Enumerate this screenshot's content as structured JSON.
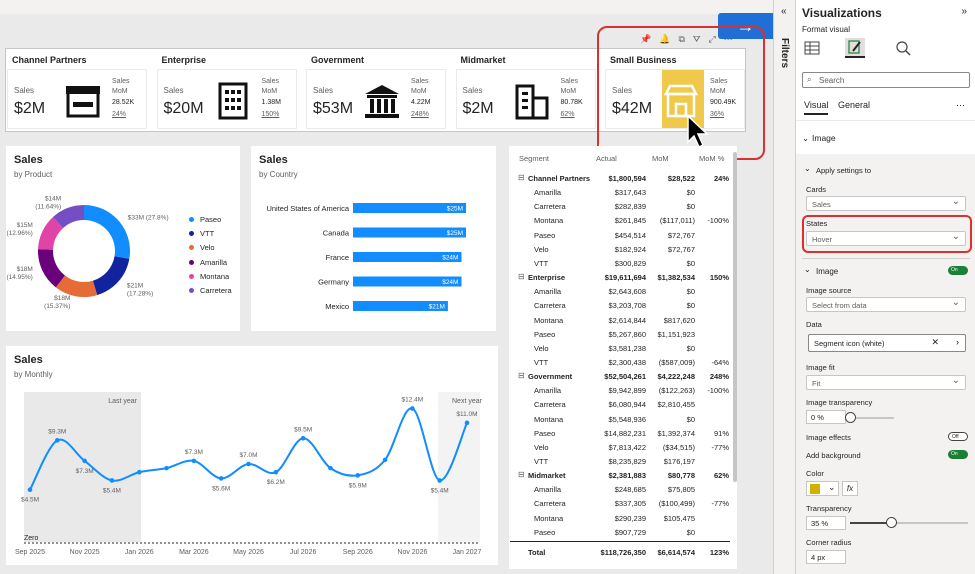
{
  "cards": [
    {
      "title": "Channel Partners",
      "sales_label": "Sales",
      "value": "$2M",
      "mom_label": "Sales MoM",
      "mom": "28.52K",
      "pct": "24%",
      "icon": "storefront-icon"
    },
    {
      "title": "Enterprise",
      "sales_label": "Sales",
      "value": "$20M",
      "mom_label": "Sales MoM",
      "mom": "1.38M",
      "pct": "150%",
      "icon": "office-building-icon"
    },
    {
      "title": "Government",
      "sales_label": "Sales",
      "value": "$53M",
      "mom_label": "Sales MoM",
      "mom": "4.22M",
      "pct": "248%",
      "icon": "government-building-icon"
    },
    {
      "title": "Midmarket",
      "sales_label": "Sales",
      "value": "$2M",
      "mom_label": "Sales MoM",
      "mom": "80.78K",
      "pct": "62%",
      "icon": "city-building-icon"
    },
    {
      "title": "Small Business",
      "sales_label": "Sales",
      "value": "$42M",
      "mom_label": "Sales MoM",
      "mom": "900.49K",
      "pct": "36%",
      "icon": "shop-icon"
    }
  ],
  "product_panel": {
    "title": "Sales",
    "subtitle": "by Product",
    "legend": [
      "Paseo",
      "VTT",
      "Velo",
      "Amarilla",
      "Montana",
      "Carretera"
    ],
    "labels": [
      "$33M (27.8%)",
      "$21M (17.28%)",
      "$18M (15.37%)",
      "$18M (14.95%)",
      "$15M (12.96%)",
      "$14M (11.64%)"
    ]
  },
  "country_panel": {
    "title": "Sales",
    "subtitle": "by Country"
  },
  "monthly_panel": {
    "title": "Sales",
    "subtitle": "by Monthly",
    "shade_left": "Last year",
    "shade_right": "Next year",
    "zero_label": "Zero",
    "xticks": [
      "Sep 2025",
      "Nov 2025",
      "Jan 2026",
      "Mar 2026",
      "May 2026",
      "Jul 2026",
      "Sep 2026",
      "Nov 2026",
      "Jan 2027"
    ]
  },
  "chart_data": [
    {
      "type": "pie",
      "title": "Sales",
      "subtitle": "by Product",
      "categories": [
        "Paseo",
        "VTT",
        "Velo",
        "Amarilla",
        "Montana",
        "Carretera"
      ],
      "values": [
        33,
        21,
        18,
        18,
        15,
        14
      ],
      "percent": [
        27.8,
        17.28,
        15.37,
        14.95,
        12.96,
        11.64
      ],
      "colors": [
        "#118dff",
        "#12239e",
        "#e66c37",
        "#6b007b",
        "#e044a7",
        "#744ec2"
      ]
    },
    {
      "type": "bar",
      "title": "Sales",
      "subtitle": "by Country",
      "categories": [
        "United States of America",
        "Canada",
        "France",
        "Germany",
        "Mexico"
      ],
      "values": [
        25,
        25,
        24,
        24,
        21
      ],
      "value_labels": [
        "$25M",
        "$25M",
        "$24M",
        "$24M",
        "$21M"
      ],
      "color": "#118dff"
    },
    {
      "type": "line",
      "title": "Sales",
      "subtitle": "by Monthly",
      "x": [
        "Sep 2025",
        "Oct 2025",
        "Nov 2025",
        "Dec 2025",
        "Jan 2026",
        "Feb 2026",
        "Mar 2026",
        "Apr 2026",
        "May 2026",
        "Jun 2026",
        "Jul 2026",
        "Aug 2026",
        "Sep 2026",
        "Oct 2026",
        "Nov 2026",
        "Dec 2026",
        "Jan 2027"
      ],
      "values": [
        4.5,
        9.3,
        7.3,
        5.4,
        6.2,
        6.6,
        7.3,
        5.6,
        7.0,
        6.2,
        9.5,
        6.6,
        5.9,
        7.4,
        12.4,
        5.4,
        11.0
      ],
      "labels": [
        "$4.5M",
        "$9.3M",
        "$7.3M",
        "$5.4M",
        "",
        "",
        "$7.3M",
        "$5.6M",
        "$7.0M",
        "$6.2M",
        "$9.5M",
        "",
        "$5.9M",
        "",
        "$12.4M",
        "$5.4M",
        "$11.0M"
      ],
      "ylim": [
        0,
        14
      ],
      "color": "#118dff"
    }
  ],
  "table": {
    "headers": [
      "Segment",
      "Actual",
      "MoM",
      "MoM %"
    ],
    "rows": [
      {
        "name": "Channel Partners",
        "actual": "$1,800,594",
        "mom": "$28,522",
        "pct": "24%",
        "level": 0
      },
      {
        "name": "Amarilla",
        "actual": "$317,643",
        "mom": "$0",
        "pct": "",
        "level": 1
      },
      {
        "name": "Carretera",
        "actual": "$282,839",
        "mom": "$0",
        "pct": "",
        "level": 1
      },
      {
        "name": "Montana",
        "actual": "$261,845",
        "mom": "($117,011)",
        "pct": "-100%",
        "level": 1
      },
      {
        "name": "Paseo",
        "actual": "$454,514",
        "mom": "$72,767",
        "pct": "",
        "level": 1
      },
      {
        "name": "Velo",
        "actual": "$182,924",
        "mom": "$72,767",
        "pct": "",
        "level": 1
      },
      {
        "name": "VTT",
        "actual": "$300,829",
        "mom": "$0",
        "pct": "",
        "level": 1
      },
      {
        "name": "Enterprise",
        "actual": "$19,611,694",
        "mom": "$1,382,534",
        "pct": "150%",
        "level": 0
      },
      {
        "name": "Amarilla",
        "actual": "$2,643,608",
        "mom": "$0",
        "pct": "",
        "level": 1
      },
      {
        "name": "Carretera",
        "actual": "$3,203,708",
        "mom": "$0",
        "pct": "",
        "level": 1
      },
      {
        "name": "Montana",
        "actual": "$2,614,844",
        "mom": "$817,620",
        "pct": "",
        "level": 1
      },
      {
        "name": "Paseo",
        "actual": "$5,267,860",
        "mom": "$1,151,923",
        "pct": "",
        "level": 1
      },
      {
        "name": "Velo",
        "actual": "$3,581,238",
        "mom": "$0",
        "pct": "",
        "level": 1
      },
      {
        "name": "VTT",
        "actual": "$2,300,438",
        "mom": "($587,009)",
        "pct": "-64%",
        "level": 1
      },
      {
        "name": "Government",
        "actual": "$52,504,261",
        "mom": "$4,222,248",
        "pct": "248%",
        "level": 0
      },
      {
        "name": "Amarilla",
        "actual": "$9,942,899",
        "mom": "($122,263)",
        "pct": "-100%",
        "level": 1
      },
      {
        "name": "Carretera",
        "actual": "$6,080,944",
        "mom": "$2,810,455",
        "pct": "",
        "level": 1
      },
      {
        "name": "Montana",
        "actual": "$5,548,936",
        "mom": "$0",
        "pct": "",
        "level": 1
      },
      {
        "name": "Paseo",
        "actual": "$14,882,231",
        "mom": "$1,392,374",
        "pct": "91%",
        "level": 1
      },
      {
        "name": "Velo",
        "actual": "$7,813,422",
        "mom": "($34,515)",
        "pct": "-77%",
        "level": 1
      },
      {
        "name": "VTT",
        "actual": "$8,235,829",
        "mom": "$176,197",
        "pct": "",
        "level": 1
      },
      {
        "name": "Midmarket",
        "actual": "$2,381,883",
        "mom": "$80,778",
        "pct": "62%",
        "level": 0
      },
      {
        "name": "Amarilla",
        "actual": "$248,685",
        "mom": "$75,805",
        "pct": "",
        "level": 1
      },
      {
        "name": "Carretera",
        "actual": "$337,305",
        "mom": "($100,499)",
        "pct": "-77%",
        "level": 1
      },
      {
        "name": "Montana",
        "actual": "$290,239",
        "mom": "$105,475",
        "pct": "",
        "level": 1
      },
      {
        "name": "Paseo",
        "actual": "$907,729",
        "mom": "$0",
        "pct": "",
        "level": 1
      }
    ],
    "total": {
      "name": "Total",
      "actual": "$118,726,350",
      "mom": "$6,614,574",
      "pct": "123%"
    }
  },
  "rail": {
    "filters": "Filters"
  },
  "viz": {
    "title": "Visualizations",
    "format_visual": "Format visual",
    "search_placeholder": "Search",
    "tab_visual": "Visual",
    "tab_general": "General",
    "section_image": "Image",
    "apply_settings": "Apply settings to",
    "cards_label": "Cards",
    "cards_value": "Sales",
    "states_label": "States",
    "states_value": "Hover",
    "image_label": "Image",
    "image_toggle": "On",
    "image_source_label": "Image source",
    "image_source_value": "Select from data",
    "data_label": "Data",
    "data_value": "Segment icon (white)",
    "image_fit_label": "Image fit",
    "image_fit_value": "Fit",
    "image_transparency_label": "Image transparency",
    "image_transparency_value": "0 %",
    "image_transparency_level": 0,
    "image_effects_label": "Image effects",
    "image_effects_toggle": "Off",
    "add_background_label": "Add background",
    "add_background_toggle": "On",
    "color_label": "Color",
    "color_value": "#d1b000",
    "fx_label": "fx",
    "transparency_label": "Transparency",
    "transparency_value": "35 %",
    "transparency_level": 35,
    "corner_radius_label": "Corner radius",
    "corner_radius_value": "4 px"
  }
}
